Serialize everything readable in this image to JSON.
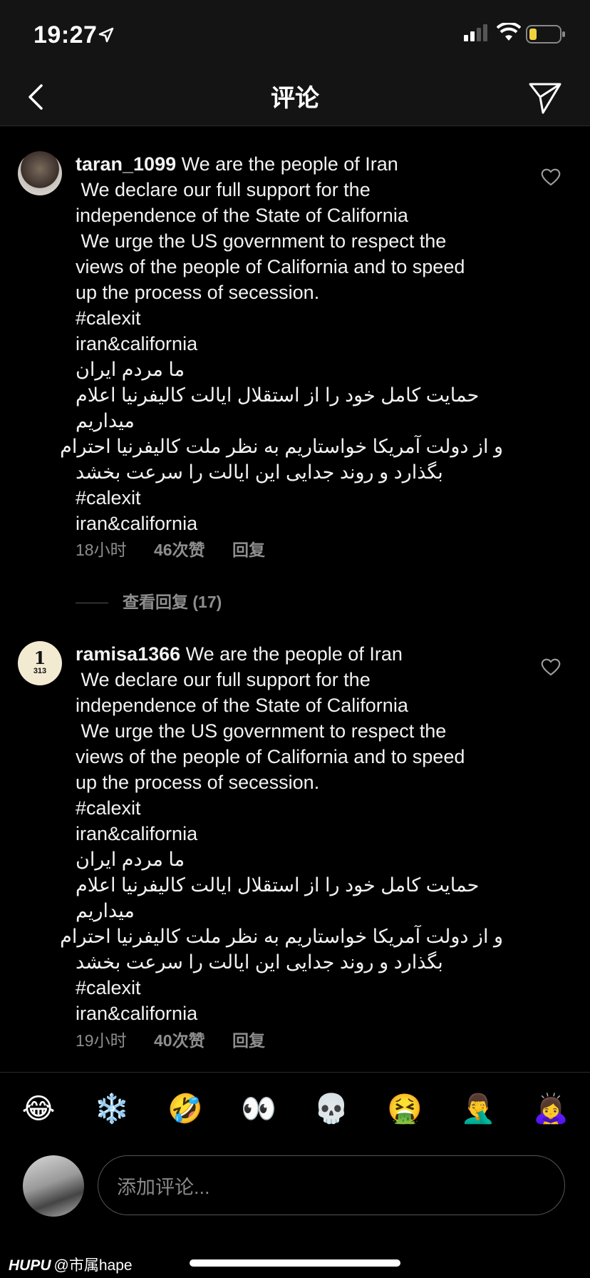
{
  "status_bar": {
    "time": "19:27"
  },
  "nav": {
    "title": "评论"
  },
  "comments": [
    {
      "username": "taran_1099",
      "lines": [
        "We are the people of Iran",
        " We declare our full support for the",
        "independence of the State of California",
        " We urge the US government to respect the",
        "views of the people of California and to speed",
        "up the process of secession.",
        "#calexit",
        "iran&california",
        "ما مردم ایران",
        "حمایت کامل خود را از استقلال ایالت کالیفرنیا اعلام",
        "میداریم",
        "و از دولت آمریکا خواستاریم به نظر ملت کالیفرنیا احترام",
        "بگذارد و روند جدایی این ایالت را سرعت بخشد",
        "#calexit",
        "iran&california"
      ],
      "time": "18小时",
      "likes": "46次赞",
      "reply": "回复",
      "view_replies": "查看回复 (17)"
    },
    {
      "username": "ramisa1366",
      "avatar_text_big": "1",
      "avatar_text_small": "313",
      "lines": [
        "We are the people of Iran",
        " We declare our full support for the",
        "independence of the State of California",
        " We urge the US government to respect the",
        "views of the people of California and to speed",
        "up the process of secession.",
        "#calexit",
        "iran&california",
        "ما مردم ایران",
        "حمایت کامل خود را از استقلال ایالت کالیفرنیا اعلام",
        "میداریم",
        "و از دولت آمریکا خواستاریم به نظر ملت کالیفرنیا احترام",
        "بگذارد و روند جدایی این ایالت را سرعت بخشد",
        "#calexit",
        "iran&california"
      ],
      "time": "19小时",
      "likes": "40次赞",
      "reply": "回复"
    }
  ],
  "emojis": [
    "😂",
    "❄️",
    "🤣",
    "👀",
    "💀",
    "🤮",
    "🤦‍♂️",
    "🙇‍♀️"
  ],
  "input": {
    "placeholder": "添加评论..."
  },
  "watermark": {
    "brand": "HUPU",
    "handle": "@市属hape"
  }
}
